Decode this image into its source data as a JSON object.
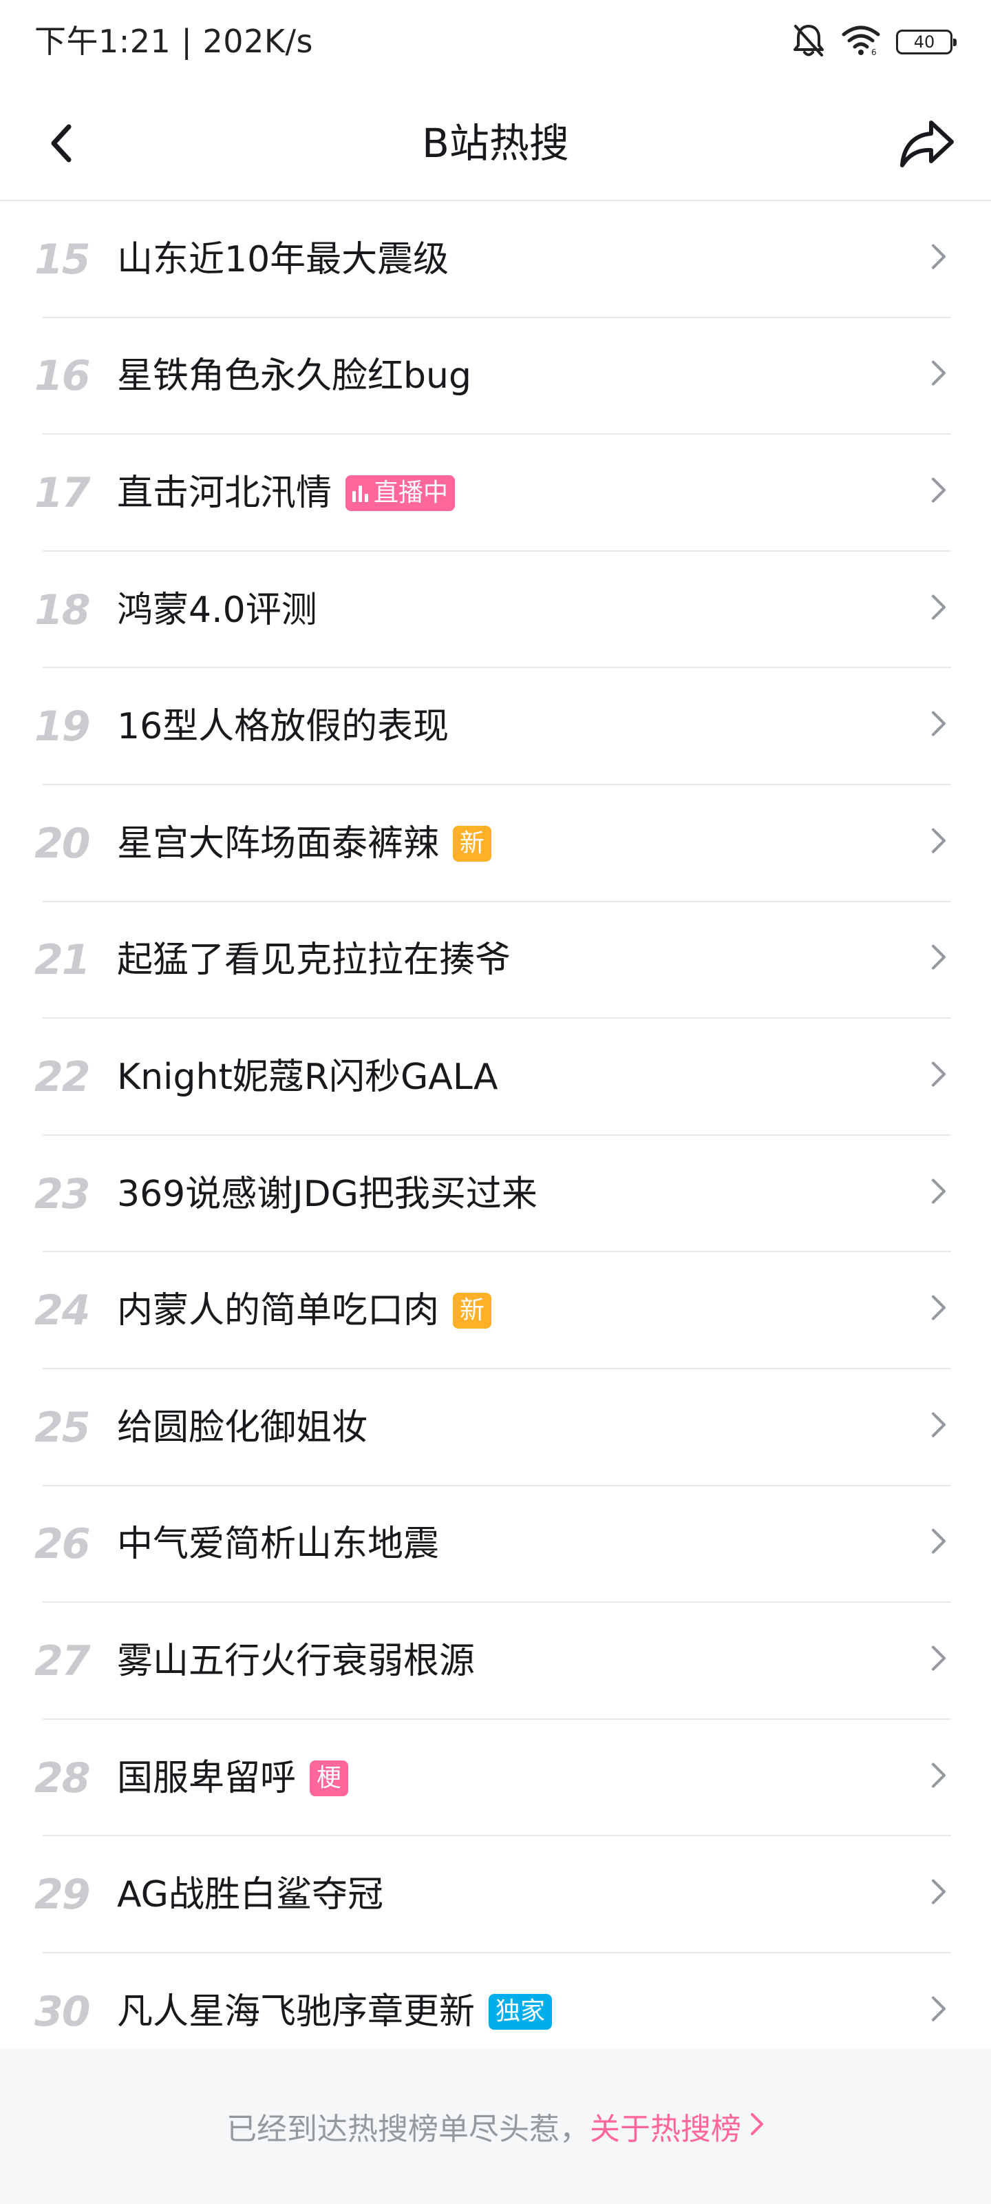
{
  "status_bar": {
    "time_text": "下午1:21 | 202K/s",
    "battery_level": "40",
    "icons": [
      "bell-off-icon",
      "wifi-icon",
      "battery-icon"
    ]
  },
  "nav": {
    "title": "B站热搜",
    "back_icon": "chevron-left-icon",
    "share_icon": "share-icon"
  },
  "colors": {
    "rank_gray": "#c9cbcf",
    "tag_pink": "#ff6699",
    "tag_orange": "#ffb027",
    "tag_blue": "#00aeec",
    "footer_bg": "#f6f7f8"
  },
  "list": {
    "items": [
      {
        "rank": "15",
        "title": "山东近10年最大震级",
        "tag": ""
      },
      {
        "rank": "16",
        "title": "星铁角色永久脸红bug",
        "tag": ""
      },
      {
        "rank": "17",
        "title": "直击河北汛情",
        "tag": "直播中"
      },
      {
        "rank": "18",
        "title": "鸿蒙4.0评测",
        "tag": ""
      },
      {
        "rank": "19",
        "title": "16型人格放假的表现",
        "tag": ""
      },
      {
        "rank": "20",
        "title": "星宫大阵场面泰裤辣",
        "tag": "新"
      },
      {
        "rank": "21",
        "title": "起猛了看见克拉拉在揍爷",
        "tag": ""
      },
      {
        "rank": "22",
        "title": "Knight妮蔻R闪秒GALA",
        "tag": ""
      },
      {
        "rank": "23",
        "title": "369说感谢JDG把我买过来",
        "tag": ""
      },
      {
        "rank": "24",
        "title": "内蒙人的简单吃口肉",
        "tag": "新"
      },
      {
        "rank": "25",
        "title": "给圆脸化御姐妆",
        "tag": ""
      },
      {
        "rank": "26",
        "title": "中气爱简析山东地震",
        "tag": ""
      },
      {
        "rank": "27",
        "title": "雾山五行火行衰弱根源",
        "tag": ""
      },
      {
        "rank": "28",
        "title": "国服卑留呼",
        "tag": "梗"
      },
      {
        "rank": "29",
        "title": "AG战胜白鲨夺冠",
        "tag": ""
      },
      {
        "rank": "30",
        "title": "凡人星海飞驰序章更新",
        "tag": "独家"
      }
    ]
  },
  "footer": {
    "end_text": "已经到达热搜榜单尽头惹，",
    "link_text": "关于热搜榜"
  }
}
